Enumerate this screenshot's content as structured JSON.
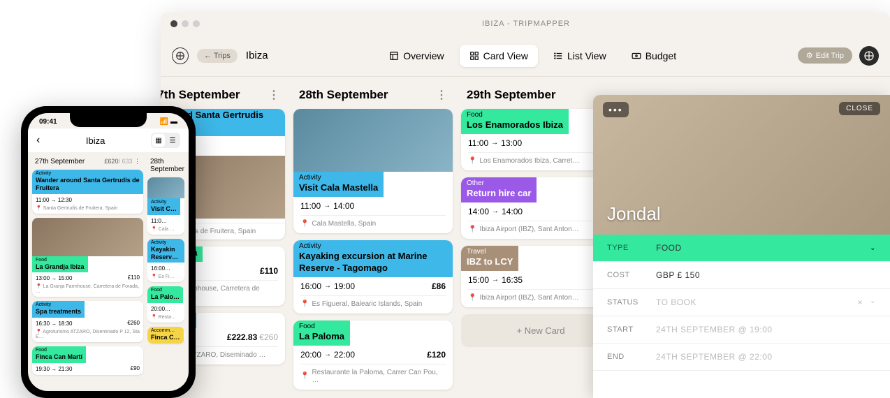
{
  "window_title": "IBIZA - TRIPMAPPER",
  "trips_back": "← Trips",
  "trip_name": "Ibiza",
  "nav": {
    "overview": "Overview",
    "card_view": "Card View",
    "list_view": "List View",
    "budget": "Budget"
  },
  "edit_trip": "Edit Trip",
  "columns": [
    {
      "date": "27th September",
      "cards": [
        {
          "type": "activity",
          "type_label": "",
          "title": "er around Santa Gertrudis Fruitera",
          "time_a": "",
          "time_b": "12:30",
          "loc": "a Gertrudis de Fruitera, Spain",
          "has_img": true,
          "img_class": "indoor"
        },
        {
          "type": "food",
          "title": "andja Ibiza",
          "time_a": "",
          "time_b": "15:00",
          "price": "£110",
          "loc": "ranja Farmhouse, Carretera de Forada, …"
        },
        {
          "type": "activity",
          "title": "eatments",
          "time_a": "",
          "time_b": "18:30",
          "price": "£222.83",
          "price_sub": "€260",
          "loc": "turismo ATZARO, Diseminado …"
        }
      ]
    },
    {
      "date": "28th September",
      "cards": [
        {
          "type": "activity",
          "type_label": "Activity",
          "title": "Visit Cala Mastella",
          "time_a": "11:00",
          "time_b": "14:00",
          "loc": "Cala Mastella, Spain",
          "has_img": true,
          "img_class": ""
        },
        {
          "type": "activity",
          "type_label": "Activity",
          "title": "Kayaking excursion at Marine Reserve - Tagomago",
          "time_a": "16:00",
          "time_b": "19:00",
          "price": "£86",
          "loc": "Es Figueral, Balearic Islands, Spain"
        },
        {
          "type": "food",
          "type_label": "Food",
          "title": "La Paloma",
          "time_a": "20:00",
          "time_b": "22:00",
          "price": "£120",
          "loc": "Restaurante la Paloma, Carrer Can Pou, …"
        }
      ]
    },
    {
      "date": "29th September",
      "cards": [
        {
          "type": "food",
          "type_label": "Food",
          "title": "Los Enamorados Ibiza",
          "time_a": "11:00",
          "time_b": "13:00",
          "loc": "Los Enamorados Ibiza, Carret…"
        },
        {
          "type": "other",
          "type_label": "Other",
          "title": "Return hire car",
          "time_a": "14:00",
          "time_b": "14:00",
          "loc": "Ibiza Airport (IBZ), Sant Anton…"
        },
        {
          "type": "travel",
          "type_label": "Travel",
          "title": "IBZ to LCY",
          "time_a": "15:00",
          "time_b": "16:35",
          "loc": "Ibiza Airport (IBZ), Sant Anton…"
        }
      ],
      "new_card": "+ New Card"
    }
  ],
  "detail": {
    "close": "CLOSE",
    "title": "Jondal",
    "type_label": "TYPE",
    "type_value": "FOOD",
    "cost_label": "COST",
    "cost_value": "GBP £ 150",
    "status_label": "STATUS",
    "status_value": "TO BOOK",
    "start_label": "START",
    "start_value": "24TH SEPTEMBER @ 19:00",
    "end_label": "END",
    "end_value": "24TH SEPTEMBER @ 22:00"
  },
  "phone": {
    "time": "09:41",
    "title": "Ibiza",
    "col1": {
      "date": "27th September",
      "budget": "£620",
      "budget_sub": "/ 633",
      "cards": [
        {
          "type": "activity",
          "type_label": "Activity",
          "title": "Wander around Santa Gertrudis de Fruitera",
          "time_a": "11:00",
          "time_b": "12:30",
          "loc": "Santa Gertrudis de Fruitera, Spain"
        },
        {
          "type": "food",
          "type_label": "Food",
          "title": "La Grandja Ibiza",
          "time_a": "13:00",
          "time_b": "15:00",
          "price": "£110",
          "loc": "La Granja Farmhouse, Carretera de Forada, …",
          "has_img": true
        },
        {
          "type": "activity",
          "type_label": "Activity",
          "title": "Spa treatments",
          "time_a": "16:30",
          "time_b": "18:30",
          "price": "€260",
          "loc": "Agroturismo ATZARO, Diseminado P 12, Sta E…"
        },
        {
          "type": "food",
          "type_label": "Food",
          "title": "Finca Can Martí",
          "time_a": "19:30",
          "time_b": "21:30",
          "price": "£90"
        }
      ]
    },
    "col2": {
      "date": "28th September",
      "cards": [
        {
          "type": "activity",
          "type_label": "Activity",
          "title": "Visit C…",
          "time_a": "11:0…",
          "loc": "Cala …",
          "has_img": true
        },
        {
          "type": "activity",
          "type_label": "Activity",
          "title": "Kayakin\nReserv…",
          "time_a": "16:00…",
          "loc": "Es Fi…"
        },
        {
          "type": "food",
          "type_label": "Food",
          "title": "La Palo…",
          "time_a": "20:00…",
          "loc": "Resta…"
        },
        {
          "type": "accom",
          "type_label": "Accomm…",
          "title": "Finca C…"
        }
      ]
    }
  }
}
